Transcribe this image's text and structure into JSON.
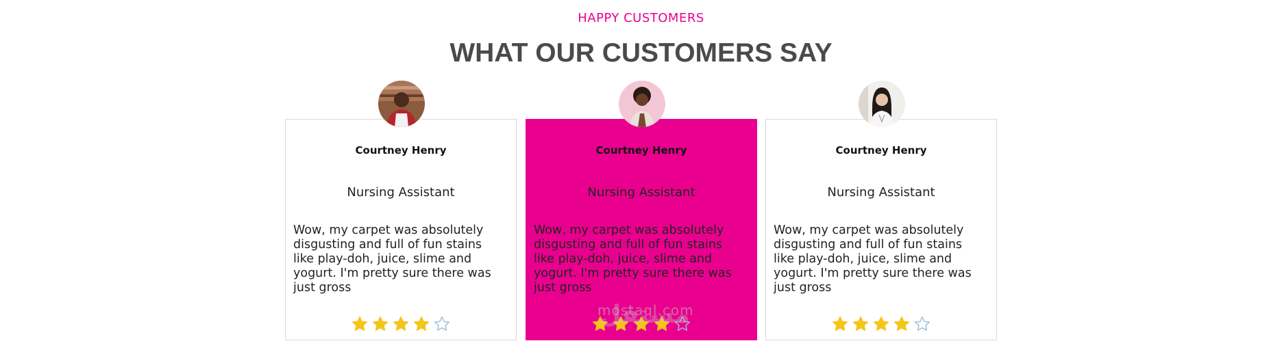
{
  "section": {
    "eyebrow": "HAPPY CUSTOMERS",
    "title": "WHAT OUR CUSTOMERS SAY"
  },
  "colors": {
    "accent": "#ea008f",
    "heading": "#4a4a4a",
    "star_filled": "#f5c518",
    "star_empty": "#9fbcd6"
  },
  "testimonials": [
    {
      "name": "Courtney Henry",
      "role": "Nursing Assistant",
      "quote": "Wow, my carpet was absolutely disgusting and full of fun stains like play-doh, juice, slime and yogurt. I'm pretty sure there was just gross",
      "rating": 4,
      "max_rating": 5,
      "avatar_icon": "man-avatar-icon",
      "featured": false
    },
    {
      "name": "Courtney Henry",
      "role": "Nursing Assistant",
      "quote": "Wow, my carpet was absolutely disgusting and full of fun stains like play-doh, juice, slime and yogurt. I'm pretty sure there was just gross",
      "rating": 4,
      "max_rating": 5,
      "avatar_icon": "woman-avatar-icon",
      "featured": true
    },
    {
      "name": "Courtney Henry",
      "role": "Nursing Assistant",
      "quote": "Wow, my carpet was absolutely disgusting and full of fun stains like play-doh, juice, slime and yogurt. I'm pretty sure there was just gross",
      "rating": 4,
      "max_rating": 5,
      "avatar_icon": "woman-avatar-icon",
      "featured": false
    }
  ],
  "watermark": {
    "latin": "mostaql.com",
    "arabic": "مستقل"
  }
}
